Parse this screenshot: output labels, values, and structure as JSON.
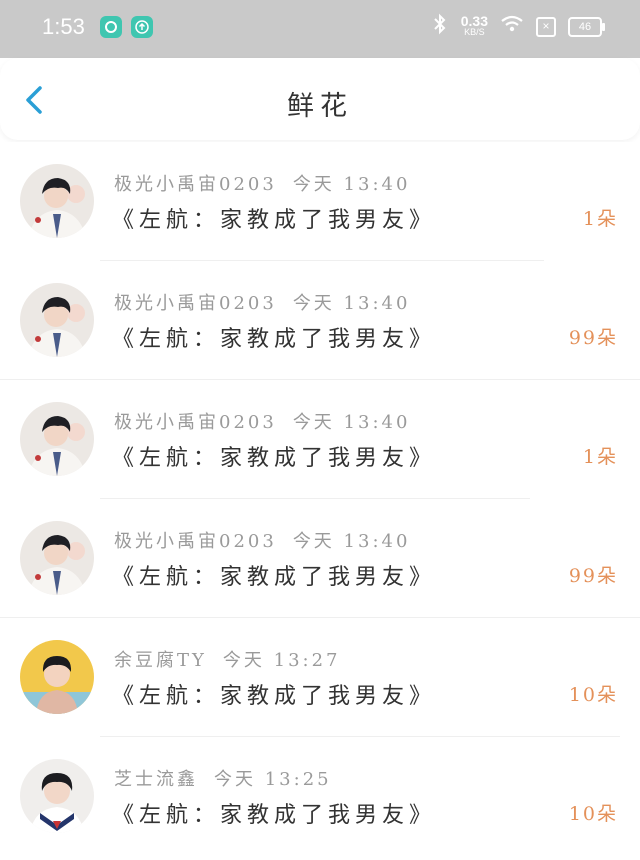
{
  "status_bar": {
    "time": "1:53",
    "net_speed_value": "0.33",
    "net_speed_unit": "KB/S",
    "battery": "46"
  },
  "header": {
    "title": "鲜花"
  },
  "rows": [
    {
      "name": "极光小禹宙0203",
      "time": "今天 13:40",
      "content": "《左航：家教成了我男友》",
      "amount": "1朵",
      "avatar": "boy-white-shirt"
    },
    {
      "name": "极光小禹宙0203",
      "time": "今天 13:40",
      "content": "《左航：家教成了我男友》",
      "amount": "99朵",
      "avatar": "boy-white-shirt"
    },
    {
      "name": "极光小禹宙0203",
      "time": "今天 13:40",
      "content": "《左航：家教成了我男友》",
      "amount": "1朵",
      "avatar": "boy-white-shirt"
    },
    {
      "name": "极光小禹宙0203",
      "time": "今天 13:40",
      "content": "《左航：家教成了我男友》",
      "amount": "99朵",
      "avatar": "boy-white-shirt"
    },
    {
      "name": "余豆腐TY",
      "time": "今天 13:27",
      "content": "《左航：家教成了我男友》",
      "amount": "10朵",
      "avatar": "child-yellow-bg"
    },
    {
      "name": "芝士流鑫",
      "time": "今天 13:25",
      "content": "《左航：家教成了我男友》",
      "amount": "10朵",
      "avatar": "boy-sailor-uniform"
    }
  ],
  "colors": {
    "status_bar_bg": "#c9c9c9",
    "back_icon": "#2a9fd6",
    "amount": "#e4915a"
  }
}
